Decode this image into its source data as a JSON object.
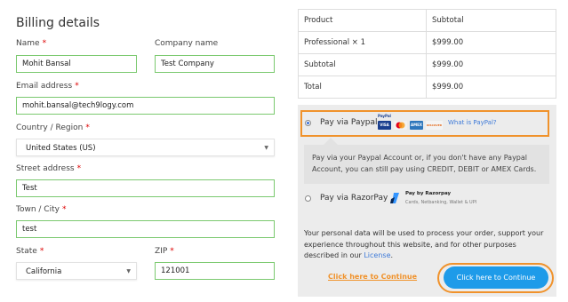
{
  "billing": {
    "title": "Billing details",
    "name_label": "Name",
    "name_value": "Mohit Bansal",
    "company_label": "Company name",
    "company_value": "Test Company",
    "email_label": "Email address",
    "email_value": "mohit.bansal@tech9logy.com",
    "country_label": "Country / Region",
    "country_value": "United States (US)",
    "street_label": "Street address",
    "street_value": "Test",
    "city_label": "Town / City",
    "city_value": "test",
    "state_label": "State",
    "state_value": "California",
    "zip_label": "ZIP",
    "zip_value": "121001",
    "required_mark": "*"
  },
  "order": {
    "headers": [
      "Product",
      "Subtotal"
    ],
    "rows": [
      [
        "Professional  × 1",
        "$999.00"
      ],
      [
        "Subtotal",
        "$999.00"
      ],
      [
        "Total",
        "$999.00"
      ]
    ]
  },
  "payment": {
    "paypal_label": "Pay via Paypal",
    "paypal_logo_text": "PayPal",
    "card_logos": [
      "VISA",
      "MC",
      "AMEX",
      "DISCOVER"
    ],
    "what_is_paypal": "What is PayPal?",
    "paypal_description": "Pay via your Paypal Account or, if you don't have any Paypal Account, you can still pay using CREDIT, DEBIT or AMEX Cards.",
    "razorpay_label": "Pay via RazorPay",
    "razorpay_title": "Pay by Razorpay",
    "razorpay_sub": "Cards, Netbanking, Wallet & UPI",
    "privacy_text": "Your personal data will be used to process your order, support your experience throughout this website, and for other purposes described in our ",
    "privacy_link": "License",
    "privacy_end": ".",
    "continue_link": "Click here to Continue",
    "continue_button": "Click here to Continue"
  },
  "colors": {
    "field_border": "#7bc96f",
    "highlight": "#f0922b",
    "button_blue": "#1e9be9",
    "link_blue": "#3e7ad8",
    "required": "#dd0000"
  }
}
